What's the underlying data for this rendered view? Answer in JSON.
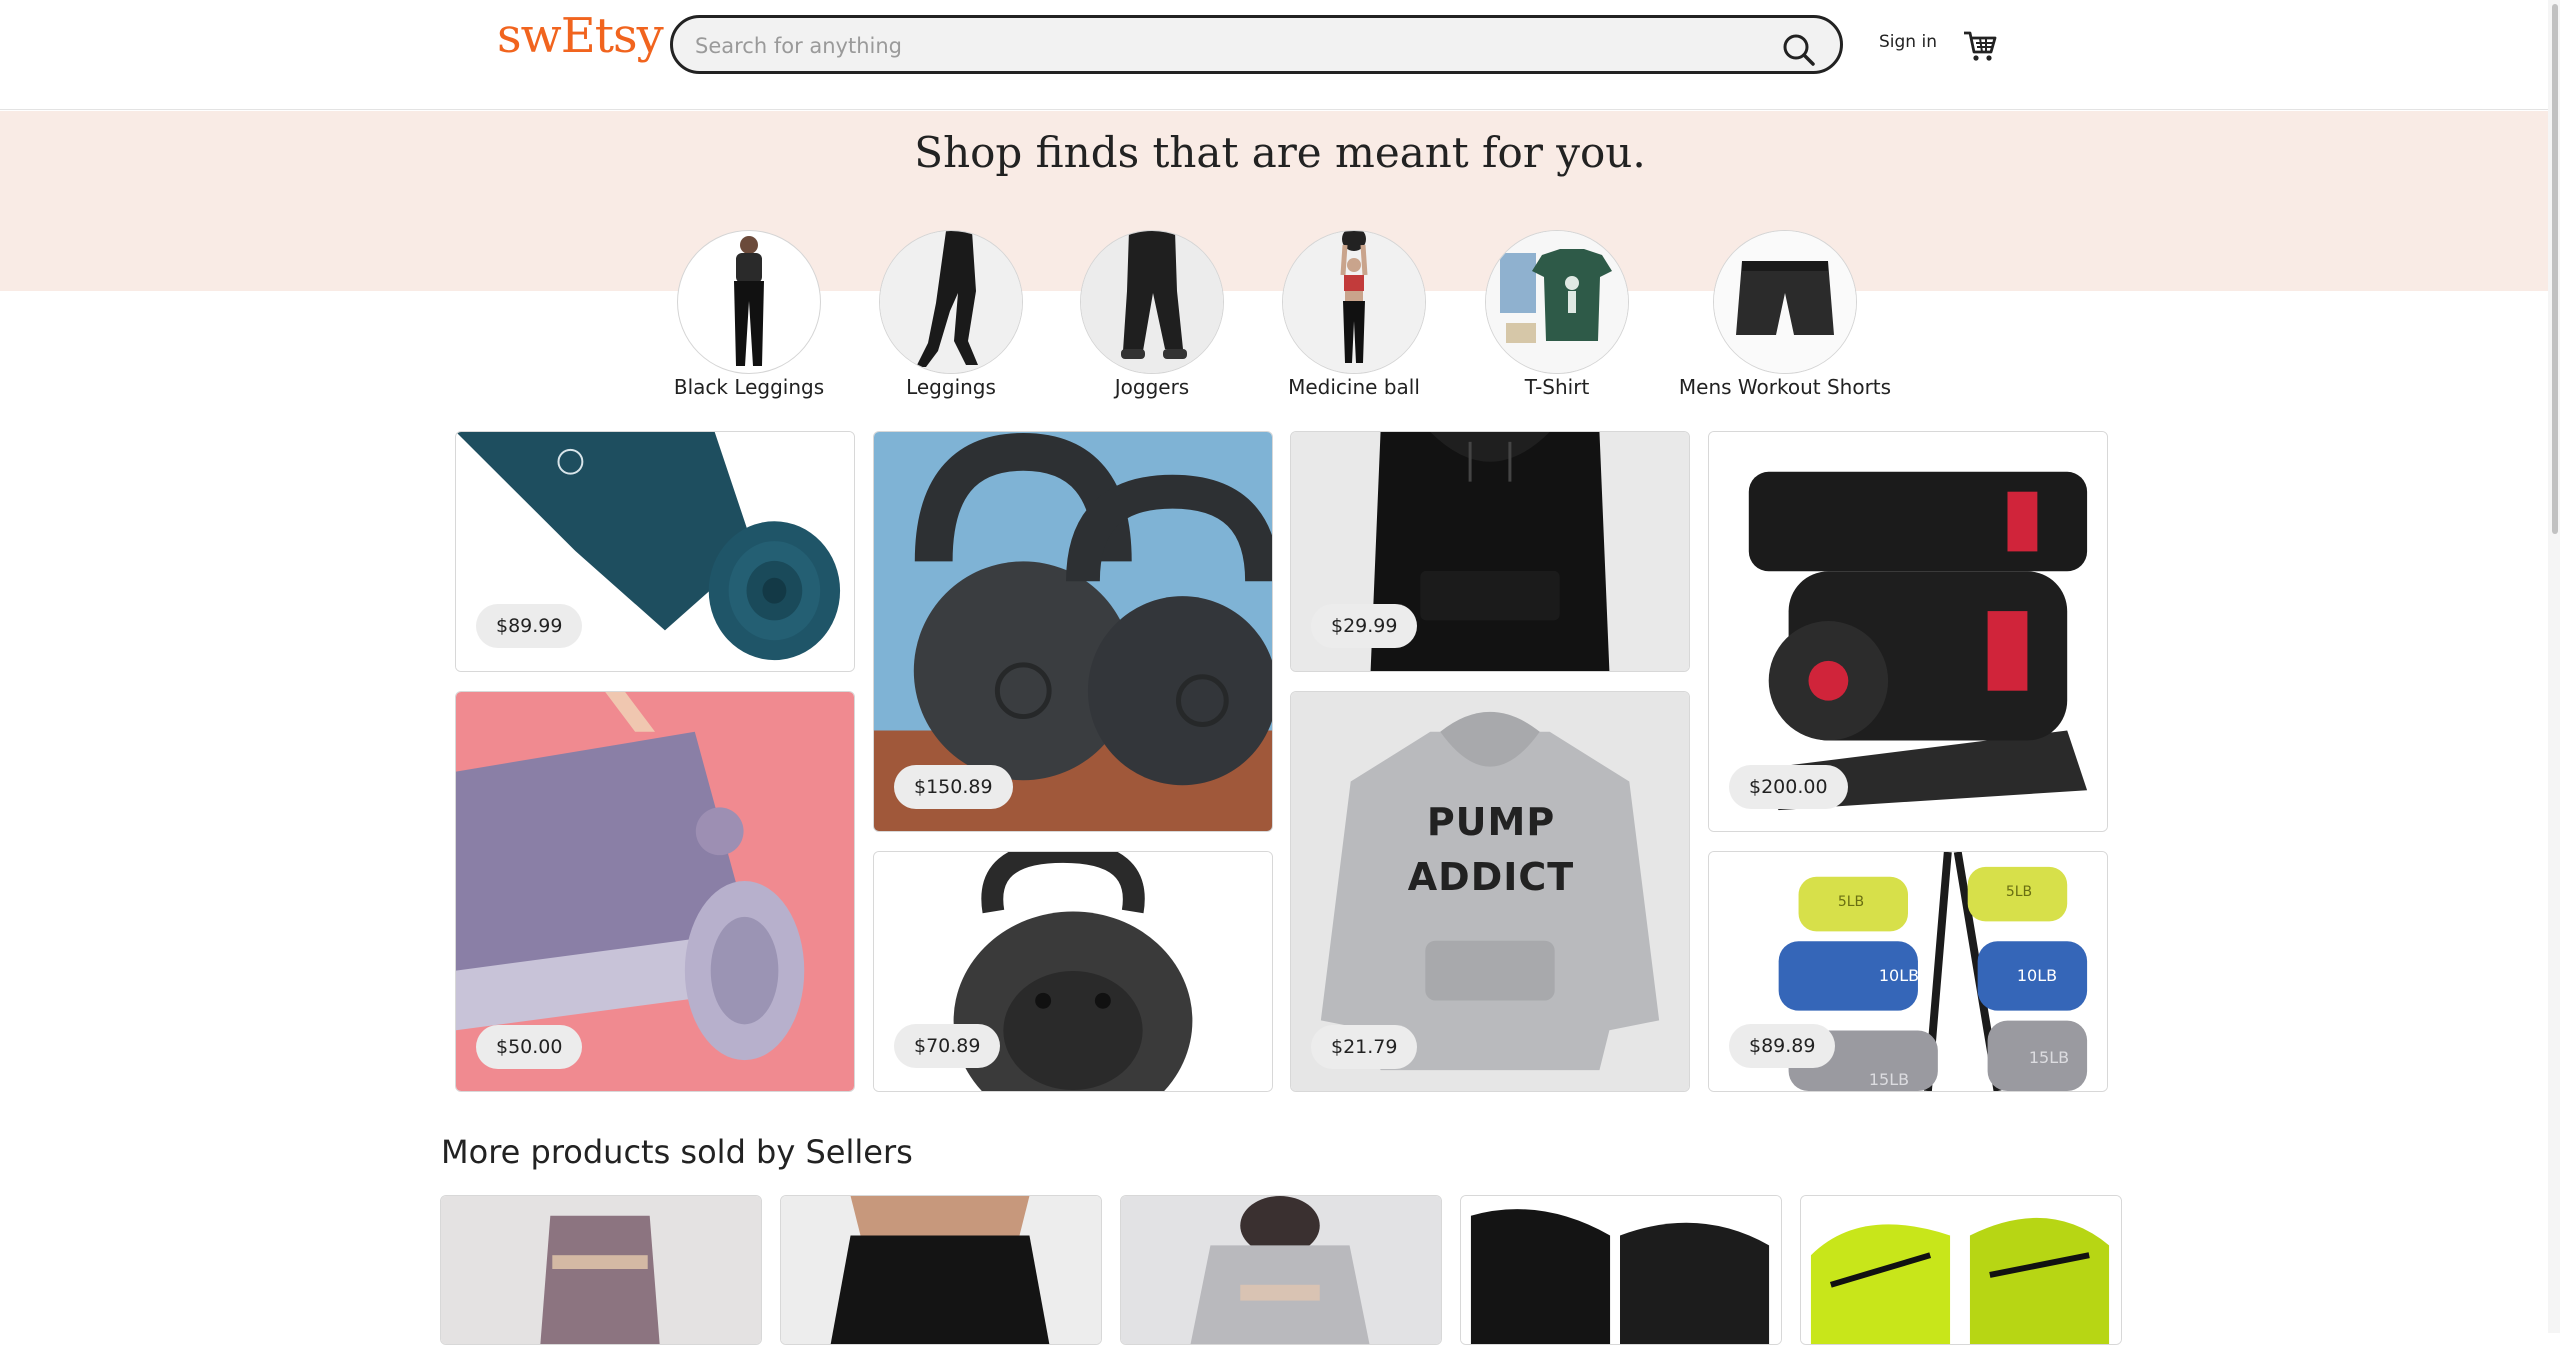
{
  "header": {
    "logo": "swEtsy",
    "search_placeholder": "Search for anything",
    "signin": "Sign in",
    "icons": {
      "search": "search-icon",
      "cart": "cart-icon"
    }
  },
  "hero": {
    "title": "Shop finds that are meant for you."
  },
  "categories": [
    {
      "label": "Black Leggings"
    },
    {
      "label": "Leggings"
    },
    {
      "label": "Joggers"
    },
    {
      "label": "Medicine ball"
    },
    {
      "label": "T-Shirt"
    },
    {
      "label": "Mens Workout Shorts"
    }
  ],
  "products": [
    {
      "image": "yoga-mat-teal",
      "price": "$89.99"
    },
    {
      "image": "kettlebells",
      "price": "$150.89"
    },
    {
      "image": "black-hoodie",
      "price": "$29.99"
    },
    {
      "image": "adjustable-dumbbells",
      "price": "$200.00"
    },
    {
      "image": "yoga-mat-purple",
      "price": "$50.00"
    },
    {
      "image": "gorilla-kettlebell",
      "price": "$70.89"
    },
    {
      "image": "pump-addict-hoodie",
      "price": "$21.79",
      "print": [
        "PUMP",
        "ADDICT"
      ]
    },
    {
      "image": "dumbbell-rack",
      "price": "$89.89",
      "labels": [
        "5LB",
        "5LB",
        "10LB",
        "10LB",
        "15LB",
        "15LB"
      ]
    }
  ],
  "more_section": {
    "title": "More products sold by Sellers",
    "items": [
      "sports-set-mauve",
      "black-joggers",
      "grey-crop-set",
      "black-sneakers",
      "neon-sneakers"
    ]
  },
  "colors": {
    "brand": "#f1641e",
    "hero_band": "#f9ebe5",
    "price_pill": "#ececec"
  }
}
